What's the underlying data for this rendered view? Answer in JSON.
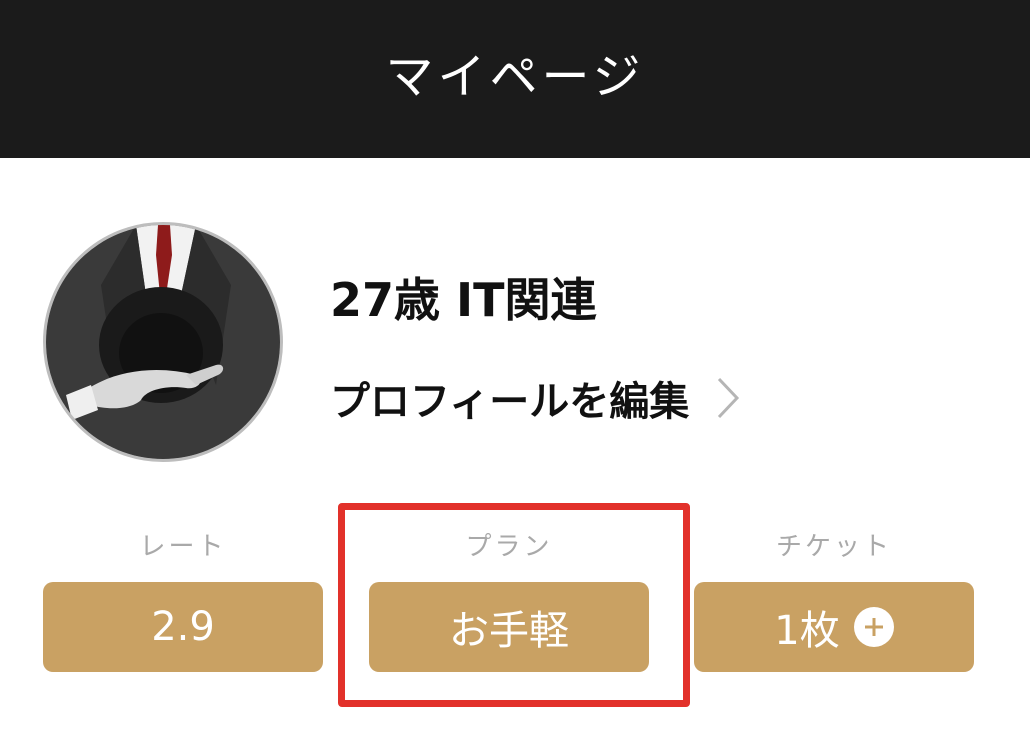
{
  "header": {
    "title": "マイページ",
    "background_color": "#1b1b1b"
  },
  "profile": {
    "avatar_icon": "user-avatar-photo",
    "name": "27歳 IT関連",
    "edit_label": "プロフィールを編集",
    "edit_icon": "chevron-right-icon"
  },
  "stats": {
    "rate": {
      "label": "レート",
      "value": "2.9"
    },
    "plan": {
      "label": "プラン",
      "value": "お手軽"
    },
    "ticket": {
      "label": "チケット",
      "value": "1枚",
      "add_icon": "plus-circle-icon"
    }
  },
  "colors": {
    "accent": "#c9a163",
    "highlight": "#e2312a",
    "label_gray": "#a9a9a9"
  }
}
